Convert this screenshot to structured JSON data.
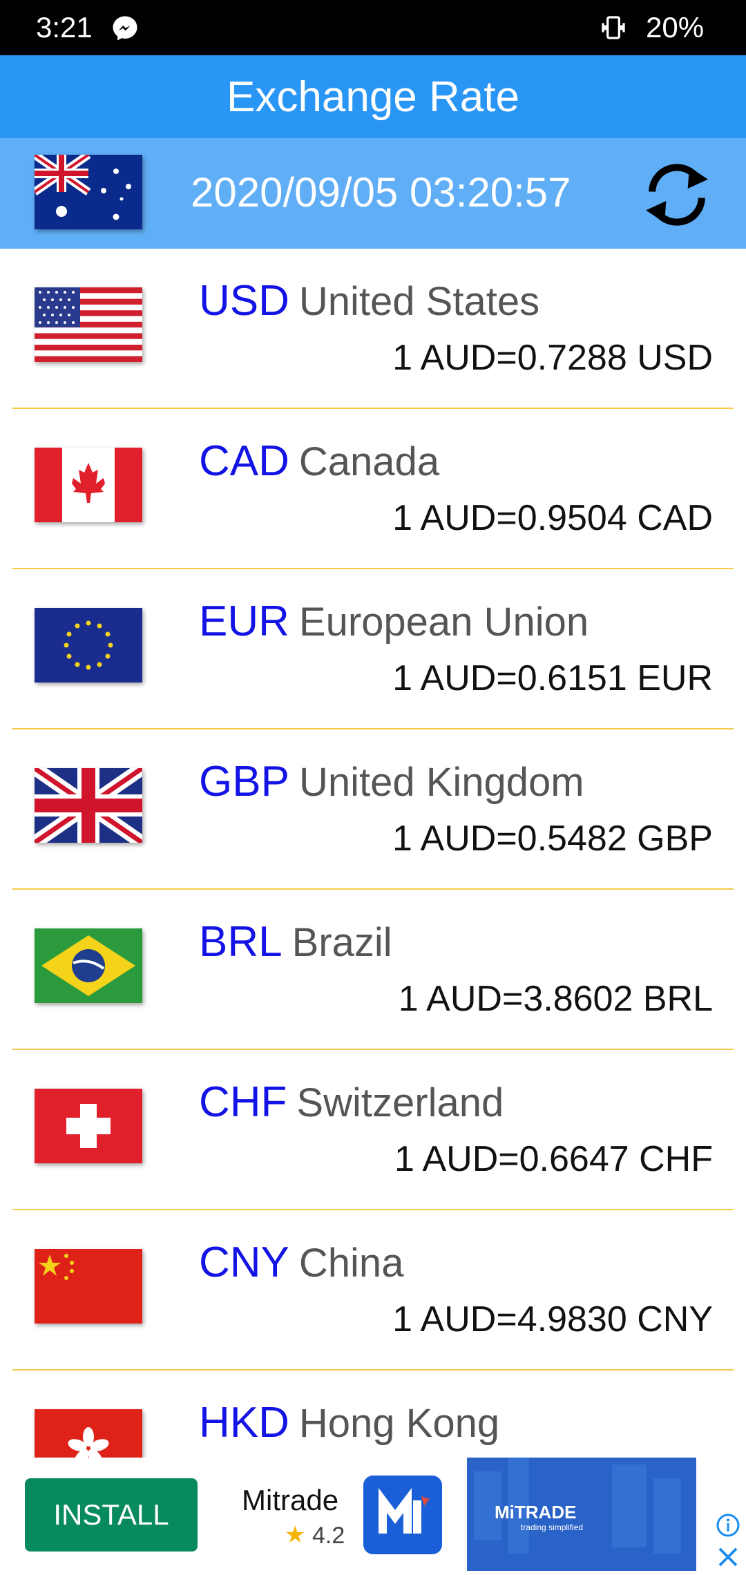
{
  "status": {
    "time": "3:21",
    "battery": "20%"
  },
  "app": {
    "title": "Exchange Rate"
  },
  "base": {
    "currency": "AUD",
    "timestamp": "2020/09/05 03:20:57"
  },
  "rates": [
    {
      "code": "USD",
      "country": "United States",
      "rate_text": "1 AUD=0.7288 USD"
    },
    {
      "code": "CAD",
      "country": "Canada",
      "rate_text": "1 AUD=0.9504 CAD"
    },
    {
      "code": "EUR",
      "country": "European Union",
      "rate_text": "1 AUD=0.6151 EUR"
    },
    {
      "code": "GBP",
      "country": "United Kingdom",
      "rate_text": "1 AUD=0.5482 GBP"
    },
    {
      "code": "BRL",
      "country": "Brazil",
      "rate_text": "1 AUD=3.8602 BRL"
    },
    {
      "code": "CHF",
      "country": "Switzerland",
      "rate_text": "1 AUD=0.6647 CHF"
    },
    {
      "code": "CNY",
      "country": "China",
      "rate_text": "1 AUD=4.9830 CNY"
    },
    {
      "code": "HKD",
      "country": "Hong Kong",
      "rate_text": ""
    }
  ],
  "ad": {
    "install_label": "INSTALL",
    "app_name": "Mitrade",
    "rating": "4.2",
    "image_brand": "MiTRADE",
    "image_tagline": "trading simplified"
  },
  "colors": {
    "appbar": "#2996F5",
    "datebar": "#60AEF6",
    "code_text": "#1313E6",
    "divider": "#F7C948",
    "install": "#088A5F"
  }
}
